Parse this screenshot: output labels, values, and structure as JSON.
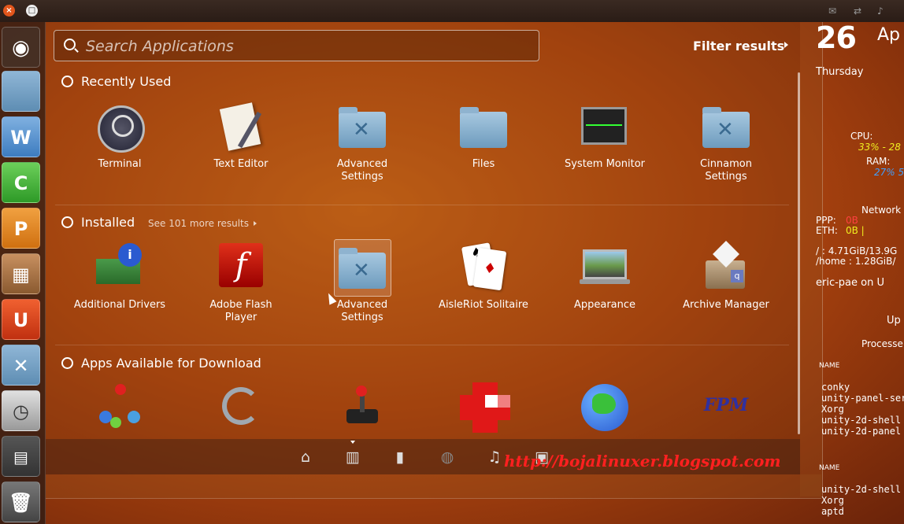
{
  "search": {
    "placeholder": "Search Applications"
  },
  "filter": {
    "label": "Filter results"
  },
  "sections": {
    "recent": {
      "title": "Recently Used"
    },
    "installed": {
      "title": "Installed",
      "see_more": "See 101 more results"
    },
    "download": {
      "title": "Apps Available for Download"
    }
  },
  "recent_apps": [
    {
      "name": "Terminal"
    },
    {
      "name": "Text Editor"
    },
    {
      "name": "Advanced Settings"
    },
    {
      "name": "Files"
    },
    {
      "name": "System Monitor"
    },
    {
      "name": "Cinnamon Settings"
    }
  ],
  "installed_apps": [
    {
      "name": "Additional Drivers"
    },
    {
      "name": "Adobe Flash Player"
    },
    {
      "name": "Advanced Settings"
    },
    {
      "name": "AisleRiot Solitaire"
    },
    {
      "name": "Appearance"
    },
    {
      "name": "Archive Manager"
    }
  ],
  "download_apps": [
    {
      "icon": "molecule-icon"
    },
    {
      "icon": "network-cable-icon"
    },
    {
      "icon": "joystick-icon"
    },
    {
      "icon": "red-blocks-icon"
    },
    {
      "icon": "globe-icon"
    },
    {
      "icon": "fpm-icon",
      "text": "FPM"
    }
  ],
  "lenses": [
    "home-lens-icon",
    "applications-lens-icon",
    "files-lens-icon",
    "social-lens-icon",
    "music-lens-icon",
    "video-lens-icon"
  ],
  "watermark": "http://bojalinuxer.blogspot.com",
  "conky": {
    "date_big": "26",
    "month": "Ap",
    "day": "Thursday",
    "cpu_label": "CPU:",
    "cpu_val": "33% - 28",
    "ram_label": "RAM:",
    "ram_val": "27% 5",
    "network": "Network",
    "ppp": "PPP:",
    "ppp_val": "0B",
    "eth": "ETH:",
    "eth_val": "0B |",
    "disk1": "/ : 4.71GiB/13.9G",
    "disk2": "/home : 1.28GiB/",
    "user": "eric-pae on U",
    "up": "Up",
    "processes": "Processe",
    "name_label": "NAME",
    "procs": [
      "conky",
      "unity-panel-ser",
      "Xorg",
      "unity-2d-shell",
      "unity-2d-panel"
    ],
    "procs2": [
      "unity-2d-shell",
      "Xorg",
      "aptd"
    ]
  },
  "colors": {
    "accent": "#e05a10",
    "watermark": "#ff2020",
    "cpu": "#f0f020",
    "ram": "#40a0ff"
  }
}
